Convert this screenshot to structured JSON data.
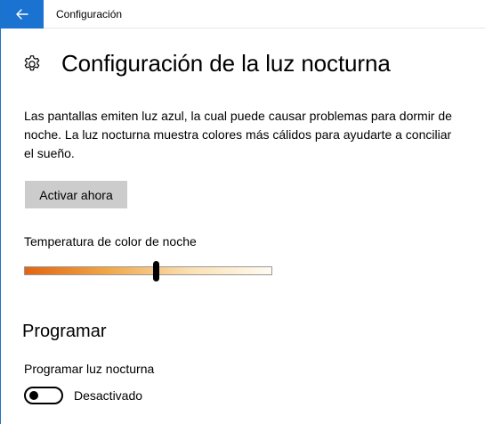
{
  "titlebar": {
    "back_icon": "arrow-left-icon",
    "app_title": "Configuración"
  },
  "page": {
    "icon": "gear-icon",
    "title": "Configuración de la luz nocturna",
    "description": "Las pantallas emiten luz azul, la cual puede causar problemas para dormir de noche. La luz nocturna muestra colores más cálidos para ayudarte a conciliar el sueño."
  },
  "activate_button": {
    "label": "Activar ahora"
  },
  "color_temperature": {
    "label": "Temperatura de color de noche",
    "value_fraction": 0.53,
    "gradient_colors": [
      "#e36410",
      "#f0a646",
      "#fbe0b3",
      "#fffbf2"
    ]
  },
  "schedule": {
    "heading": "Programar",
    "toggle_label": "Programar luz nocturna",
    "toggle_state_text": "Desactivado",
    "enabled": false
  },
  "colors": {
    "accent": "#1a73d1",
    "button_bg": "#cccccc"
  }
}
